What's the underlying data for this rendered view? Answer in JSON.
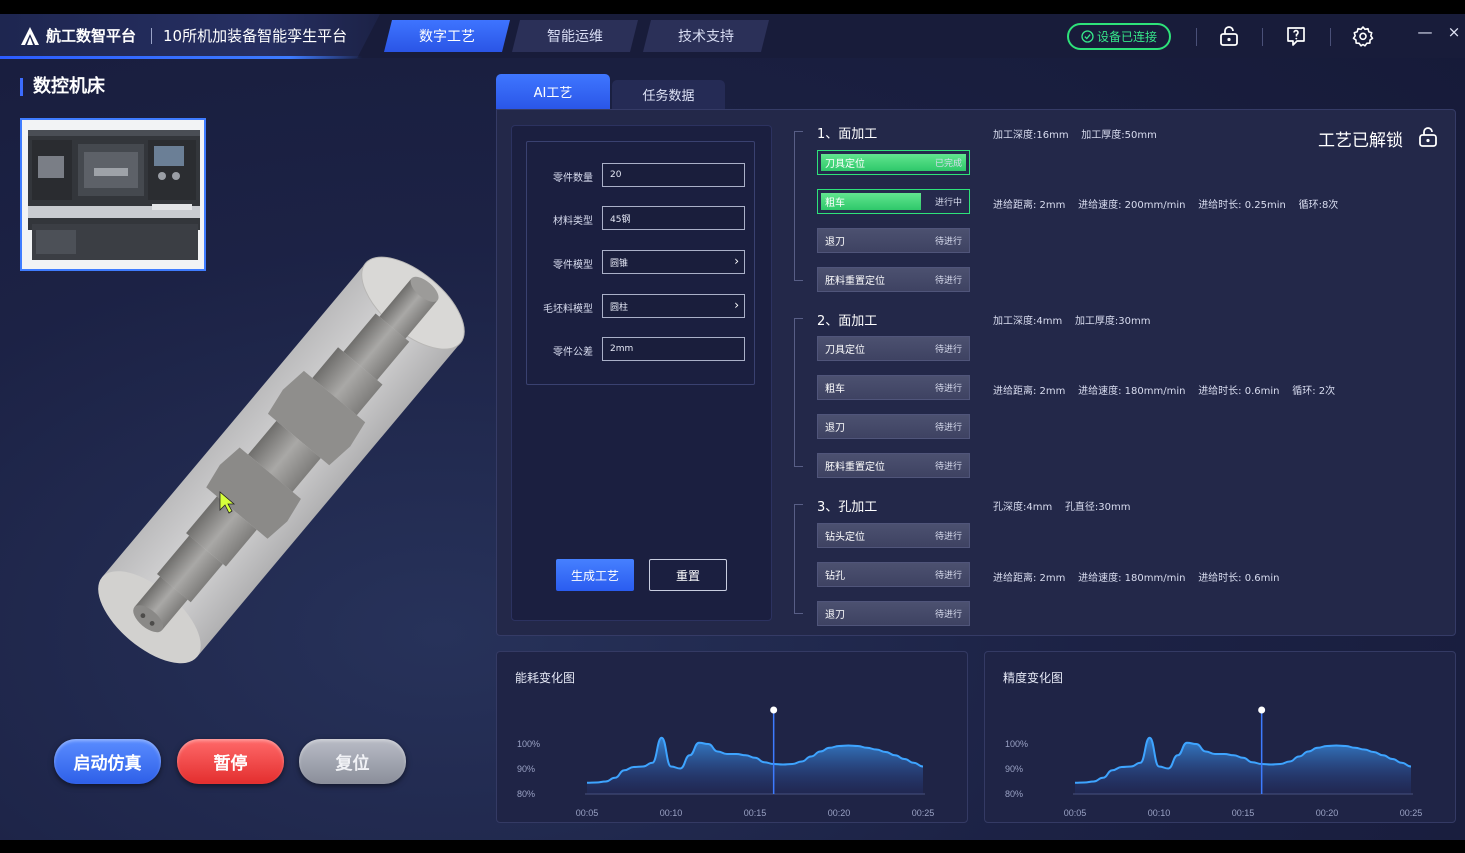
{
  "header": {
    "brand_name": "航工数智平台",
    "brand_subtitle": "10所机加装备智能孪生平台",
    "nav_tabs": [
      {
        "label": "数字工艺",
        "active": true
      },
      {
        "label": "智能运维",
        "active": false
      },
      {
        "label": "技术支持",
        "active": false
      }
    ],
    "connection_status": "设备已连接",
    "icons": [
      "unlock-icon",
      "help-icon",
      "settings-icon"
    ],
    "minimize": "—",
    "close": "×"
  },
  "left": {
    "title": "数控机床",
    "buttons": {
      "start": "启动仿真",
      "pause": "暂停",
      "reset": "复位"
    }
  },
  "panel_tabs": [
    {
      "label": "AI工艺",
      "active": true
    },
    {
      "label": "任务数据",
      "active": false
    }
  ],
  "form": {
    "fields": [
      {
        "label": "零件数量",
        "value": "20",
        "type": "text"
      },
      {
        "label": "材料类型",
        "value": "45钢",
        "type": "text"
      },
      {
        "label": "零件模型",
        "value": "圆锥",
        "type": "select"
      },
      {
        "label": "毛坯料模型",
        "value": "圆柱",
        "type": "select"
      },
      {
        "label": "零件公差",
        "value": "2mm",
        "type": "text"
      }
    ],
    "generate_label": "生成工艺",
    "reset_label": "重置"
  },
  "process": {
    "lock_status": "工艺已解锁",
    "sections": [
      {
        "title": "1、面加工",
        "info": [
          "加工深度:16mm",
          "加工厚度:50mm"
        ],
        "steps": [
          {
            "name": "刀具定位",
            "status": "已完成",
            "progress": 1.0,
            "state": "done"
          },
          {
            "name": "粗车",
            "status": "进行中",
            "progress": 0.68,
            "state": "active",
            "details": [
              "进给距离: 2mm",
              "进给速度: 200mm/min",
              "进给时长: 0.25min",
              "循环:8次"
            ]
          },
          {
            "name": "退刀",
            "status": "待进行",
            "progress": 0,
            "state": "pending"
          },
          {
            "name": "胚料重置定位",
            "status": "待进行",
            "progress": 0,
            "state": "pending"
          }
        ]
      },
      {
        "title": "2、面加工",
        "info": [
          "加工深度:4mm",
          "加工厚度:30mm"
        ],
        "steps": [
          {
            "name": "刀具定位",
            "status": "待进行",
            "progress": 0,
            "state": "pending"
          },
          {
            "name": "粗车",
            "status": "待进行",
            "progress": 0,
            "state": "pending",
            "details": [
              "进给距离: 2mm",
              "进给速度: 180mm/min",
              "进给时长: 0.6min",
              "循环: 2次"
            ]
          },
          {
            "name": "退刀",
            "status": "待进行",
            "progress": 0,
            "state": "pending"
          },
          {
            "name": "胚料重置定位",
            "status": "待进行",
            "progress": 0,
            "state": "pending"
          }
        ]
      },
      {
        "title": "3、孔加工",
        "info": [
          "孔深度:4mm",
          "孔直径:30mm"
        ],
        "steps": [
          {
            "name": "钻头定位",
            "status": "待进行",
            "progress": 0,
            "state": "pending"
          },
          {
            "name": "钻孔",
            "status": "待进行",
            "progress": 0,
            "state": "pending",
            "details": [
              "进给距离: 2mm",
              "进给速度: 180mm/min",
              "进给时长: 0.6min"
            ]
          },
          {
            "name": "退刀",
            "status": "待进行",
            "progress": 0,
            "state": "pending"
          }
        ]
      }
    ]
  },
  "chart_data": [
    {
      "type": "area",
      "title": "能耗变化图",
      "y_ticks": [
        "100%",
        "90%",
        "80%"
      ],
      "x_ticks": [
        "00:05",
        "00:10",
        "00:15",
        "00:20",
        "00:25"
      ],
      "ylim": [
        80,
        100
      ],
      "x": [
        0,
        1,
        2,
        3,
        4,
        5,
        6,
        7,
        8,
        9,
        10,
        11,
        12,
        13,
        14,
        15,
        16,
        17,
        18,
        19,
        20,
        21,
        22,
        23,
        24,
        25,
        26,
        27,
        28,
        29,
        30,
        31,
        32,
        33,
        34,
        35,
        36,
        37,
        38,
        39,
        40
      ],
      "values": [
        84.5,
        84.6,
        85,
        86.5,
        89.5,
        90.8,
        91,
        92.5,
        102.5,
        91,
        90.2,
        95.5,
        100.5,
        100,
        97,
        96,
        96,
        95.5,
        94.5,
        92.7,
        92,
        91.8,
        92,
        93,
        95,
        97,
        98.5,
        99.2,
        99.4,
        99.2,
        98.5,
        97.8,
        96.8,
        95.5,
        94,
        92.5,
        91
      ],
      "marker_x": 20,
      "grid": false
    },
    {
      "type": "area",
      "title": "精度变化图",
      "y_ticks": [
        "100%",
        "90%",
        "80%"
      ],
      "x_ticks": [
        "00:05",
        "00:10",
        "00:15",
        "00:20",
        "00:25"
      ],
      "ylim": [
        80,
        100
      ],
      "x": [
        0,
        1,
        2,
        3,
        4,
        5,
        6,
        7,
        8,
        9,
        10,
        11,
        12,
        13,
        14,
        15,
        16,
        17,
        18,
        19,
        20,
        21,
        22,
        23,
        24,
        25,
        26,
        27,
        28,
        29,
        30,
        31,
        32,
        33,
        34,
        35,
        36,
        37,
        38,
        39,
        40
      ],
      "values": [
        84.5,
        84.6,
        85,
        86.5,
        89.5,
        90.8,
        91,
        92.5,
        102.5,
        91,
        90.2,
        95.5,
        100.5,
        100,
        97,
        96,
        96,
        95.5,
        94.5,
        92.7,
        92,
        91.8,
        92,
        93,
        95,
        97,
        98.5,
        99.2,
        99.4,
        99.2,
        98.5,
        97.8,
        96.8,
        95.5,
        94,
        92.5,
        91
      ],
      "marker_x": 20,
      "grid": false
    }
  ],
  "colors": {
    "accent": "#3c6cff",
    "success": "#2ee27a",
    "danger": "#e32e2e",
    "chart_line": "#3ea4ff"
  }
}
